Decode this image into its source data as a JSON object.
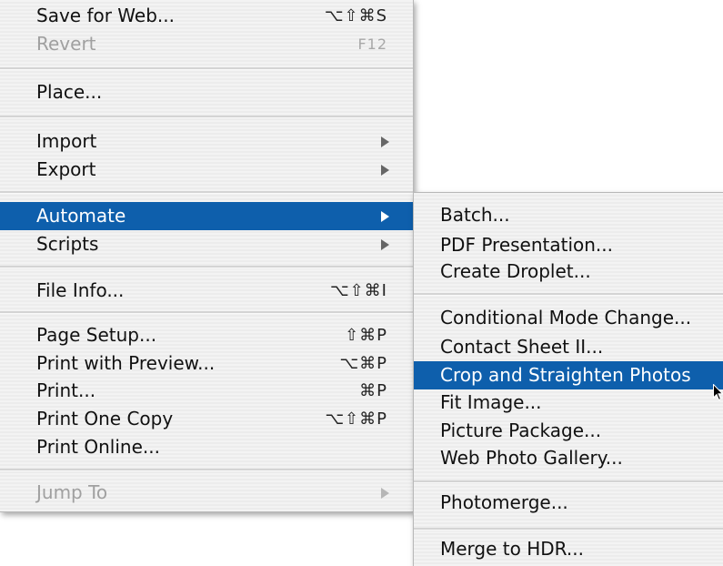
{
  "file_menu": {
    "save_for_web": {
      "label": "Save for Web...",
      "shortcut": "⌥⇧⌘S"
    },
    "revert": {
      "label": "Revert",
      "shortcut": "F12"
    },
    "place": {
      "label": "Place..."
    },
    "import": {
      "label": "Import"
    },
    "export": {
      "label": "Export"
    },
    "automate": {
      "label": "Automate"
    },
    "scripts": {
      "label": "Scripts"
    },
    "file_info": {
      "label": "File Info...",
      "shortcut": "⌥⇧⌘I"
    },
    "page_setup": {
      "label": "Page Setup...",
      "shortcut": "⇧⌘P"
    },
    "print_with_preview": {
      "label": "Print with Preview...",
      "shortcut": "⌥⌘P"
    },
    "print": {
      "label": "Print...",
      "shortcut": "⌘P"
    },
    "print_one_copy": {
      "label": "Print One Copy",
      "shortcut": "⌥⇧⌘P"
    },
    "print_online": {
      "label": "Print Online..."
    },
    "jump_to": {
      "label": "Jump To"
    }
  },
  "automate_submenu": {
    "batch": "Batch...",
    "pdf_presentation": "PDF Presentation...",
    "create_droplet": "Create Droplet...",
    "conditional_mode_change": "Conditional Mode Change...",
    "contact_sheet": "Contact Sheet II...",
    "crop_and_straighten": "Crop and Straighten Photos",
    "fit_image": "Fit Image...",
    "picture_package": "Picture Package...",
    "web_photo_gallery": "Web Photo Gallery...",
    "photomerge": "Photomerge...",
    "merge_to_hdr": "Merge to HDR..."
  },
  "colors": {
    "highlight": "#0e5fac",
    "text": "#111111",
    "disabled": "#a0a0a0"
  }
}
